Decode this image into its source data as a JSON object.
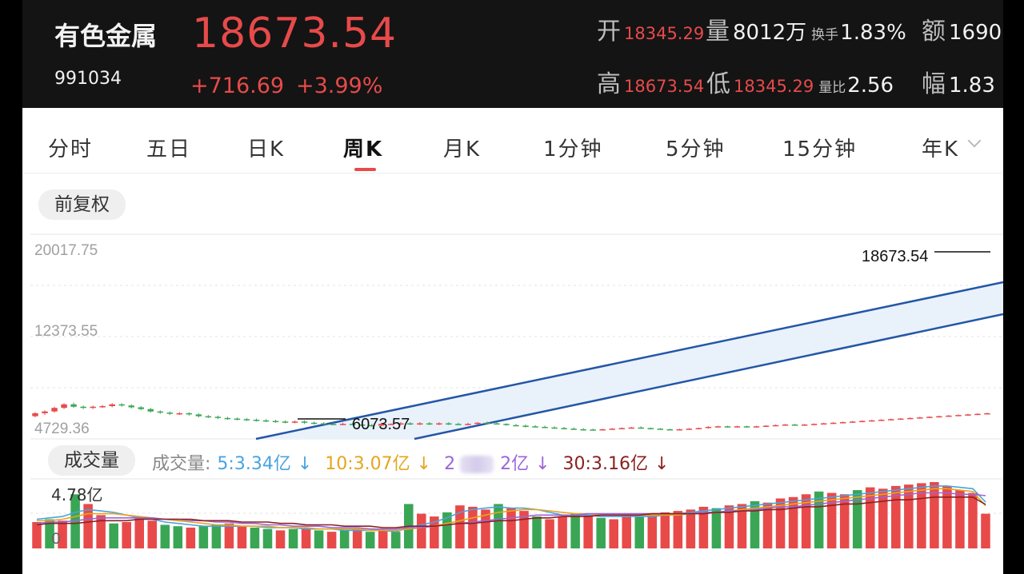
{
  "quote": {
    "name": "有色金属",
    "code": "991034",
    "price": "18673.54",
    "change": "+716.69",
    "change_pct": "+3.99%",
    "open_label": "开",
    "open": "18345.29",
    "volume_label": "量",
    "volume": "8012万",
    "turnover_label": "换手",
    "turnover": "1.83%",
    "amount_label": "额",
    "amount": "1690",
    "high_label": "高",
    "high": "18673.54",
    "low_label": "低",
    "low": "18345.29",
    "volratio_label": "量比",
    "volratio": "2.56",
    "amp_label": "幅",
    "amp": "1.83",
    "up_color": "#e84a4a",
    "down_color": "#3aa655"
  },
  "tabs": [
    {
      "label": "分时"
    },
    {
      "label": "五日"
    },
    {
      "label": "日K"
    },
    {
      "label": "周K",
      "active": true
    },
    {
      "label": "月K"
    },
    {
      "label": "1分钟"
    },
    {
      "label": "5分钟"
    },
    {
      "label": "15分钟"
    },
    {
      "label": "年K"
    }
  ],
  "adjust_label": "前复权",
  "volume_panel": {
    "title": "成交量",
    "legend_prefix": "成交量:",
    "ma5": "5:3.34亿",
    "ma10": "10:3.07亿",
    "ma20_a": "2",
    "ma20_b": "2亿",
    "ma30": "30:3.16亿",
    "down_arrow": "↓",
    "max_label": "4.78亿",
    "zero_label": "0"
  },
  "chart_data": [
    {
      "type": "candlestick",
      "ylim": [
        4729.36,
        20017.75
      ],
      "y_ticks": [
        "20017.75",
        "12373.55",
        "4729.36"
      ],
      "annotations": [
        {
          "text": "18673.54",
          "value": 18673.54,
          "kind": "latest"
        },
        {
          "text": "6073.57",
          "value": 6073.57,
          "kind": "low"
        }
      ],
      "candles": [
        [
          5900,
          6150,
          6250,
          5800
        ],
        [
          6150,
          6300,
          6400,
          6000
        ],
        [
          6300,
          6600,
          6700,
          6200
        ],
        [
          6600,
          6900,
          7000,
          6500
        ],
        [
          6900,
          6700,
          7050,
          6600
        ],
        [
          6700,
          6600,
          6800,
          6500
        ],
        [
          6600,
          6700,
          6800,
          6500
        ],
        [
          6700,
          6750,
          6850,
          6600
        ],
        [
          6750,
          6900,
          7000,
          6650
        ],
        [
          6900,
          6800,
          7000,
          6700
        ],
        [
          6800,
          6650,
          6900,
          6550
        ],
        [
          6650,
          6500,
          6750,
          6400
        ],
        [
          6500,
          6300,
          6600,
          6200
        ],
        [
          6300,
          6200,
          6400,
          6100
        ],
        [
          6200,
          6100,
          6300,
          6000
        ],
        [
          6100,
          6150,
          6250,
          6000
        ],
        [
          6150,
          6050,
          6250,
          5950
        ],
        [
          6050,
          5900,
          6150,
          5800
        ],
        [
          5900,
          5850,
          6000,
          5750
        ],
        [
          5850,
          5750,
          5950,
          5650
        ],
        [
          5750,
          5700,
          5850,
          5600
        ],
        [
          5700,
          5650,
          5800,
          5550
        ],
        [
          5650,
          5600,
          5750,
          5500
        ],
        [
          5600,
          5550,
          5700,
          5450
        ],
        [
          5550,
          5500,
          5650,
          5400
        ],
        [
          5500,
          5450,
          5600,
          5350
        ],
        [
          5450,
          5400,
          5550,
          5300
        ],
        [
          5400,
          5450,
          5550,
          5300
        ],
        [
          5450,
          5350,
          5550,
          5250
        ],
        [
          5350,
          5300,
          5450,
          5200
        ],
        [
          5300,
          5250,
          5400,
          5200
        ],
        [
          5250,
          5200,
          5350,
          5150
        ],
        [
          5200,
          5250,
          5350,
          5150
        ],
        [
          5250,
          5200,
          5350,
          5150
        ],
        [
          5200,
          5150,
          5300,
          5050
        ],
        [
          5150,
          5100,
          5250,
          5000
        ],
        [
          5100,
          5250,
          5350,
          5050
        ],
        [
          5250,
          5250,
          5300,
          5200
        ],
        [
          5250,
          5300,
          5400,
          5150
        ],
        [
          5300,
          5250,
          5400,
          5150
        ],
        [
          5250,
          5300,
          5400,
          5150
        ],
        [
          5300,
          5250,
          5400,
          5150
        ],
        [
          5250,
          5300,
          5400,
          5150
        ],
        [
          5300,
          5250,
          5400,
          5150
        ],
        [
          5250,
          5200,
          5350,
          5150
        ],
        [
          5200,
          5250,
          5350,
          5150
        ],
        [
          5250,
          5350,
          5400,
          5200
        ],
        [
          5350,
          5300,
          5450,
          5250
        ],
        [
          5300,
          5250,
          5400,
          5200
        ],
        [
          5250,
          5150,
          5300,
          5100
        ],
        [
          5150,
          5100,
          5250,
          5050
        ],
        [
          5100,
          5050,
          5200,
          4950
        ],
        [
          5050,
          5000,
          5150,
          4950
        ],
        [
          5000,
          4950,
          5100,
          4900
        ],
        [
          4950,
          4900,
          5050,
          4850
        ],
        [
          4900,
          4850,
          5000,
          4800
        ],
        [
          4850,
          4800,
          4950,
          4750
        ],
        [
          4800,
          4780,
          4900,
          4730
        ],
        [
          4780,
          4750,
          4850,
          4730
        ],
        [
          4750,
          4800,
          4850,
          4730
        ],
        [
          4800,
          4850,
          4900,
          4750
        ],
        [
          4850,
          4900,
          4950,
          4800
        ],
        [
          4900,
          4950,
          5000,
          4850
        ],
        [
          4950,
          4900,
          5050,
          4850
        ],
        [
          4900,
          4850,
          4950,
          4800
        ],
        [
          4850,
          4800,
          4900,
          4750
        ],
        [
          4800,
          4750,
          4850,
          4730
        ],
        [
          4750,
          4800,
          4850,
          4730
        ],
        [
          4800,
          4850,
          4900,
          4760
        ],
        [
          4850,
          4900,
          4950,
          4800
        ],
        [
          4900,
          5000,
          5050,
          4850
        ],
        [
          5000,
          5050,
          5100,
          4950
        ],
        [
          5050,
          5000,
          5100,
          4950
        ],
        [
          5000,
          5050,
          5100,
          4950
        ],
        [
          5050,
          5000,
          5100,
          4950
        ],
        [
          5000,
          5050,
          5100,
          4950
        ],
        [
          5050,
          5100,
          5150,
          5000
        ],
        [
          5100,
          5150,
          5200,
          5050
        ],
        [
          5150,
          5200,
          5250,
          5100
        ],
        [
          5200,
          5150,
          5250,
          5100
        ],
        [
          5150,
          5200,
          5250,
          5100
        ],
        [
          5200,
          5250,
          5300,
          5150
        ],
        [
          5250,
          5300,
          5350,
          5200
        ],
        [
          5300,
          5350,
          5400,
          5250
        ],
        [
          5350,
          5400,
          5450,
          5300
        ],
        [
          5400,
          5450,
          5500,
          5350
        ],
        [
          5450,
          5500,
          5550,
          5400
        ],
        [
          5500,
          5550,
          5600,
          5450
        ],
        [
          5550,
          5600,
          5650,
          5500
        ],
        [
          5600,
          5650,
          5700,
          5550
        ],
        [
          5650,
          5700,
          5750,
          5600
        ],
        [
          5700,
          5750,
          5800,
          5650
        ],
        [
          5750,
          5800,
          5850,
          5700
        ],
        [
          5800,
          5850,
          5900,
          5750
        ],
        [
          5850,
          5900,
          5950,
          5800
        ],
        [
          5900,
          5950,
          6000,
          5850
        ],
        [
          5950,
          6000,
          6050,
          5900
        ],
        [
          6000,
          6050,
          6100,
          5950
        ],
        [
          6050,
          6100,
          6150,
          6000
        ],
        [
          6100,
          6150,
          6200,
          6050
        ]
      ],
      "note": "weekly K-line; values are approximate readings"
    },
    {
      "type": "bar",
      "title": "成交量",
      "ylim": [
        0,
        4.78
      ],
      "unit": "亿",
      "values": [
        1.9,
        2.1,
        2.0,
        3.9,
        3.2,
        2.4,
        1.8,
        1.9,
        2.3,
        2.0,
        1.7,
        1.6,
        1.5,
        1.6,
        1.7,
        1.8,
        1.6,
        1.5,
        1.4,
        1.3,
        1.4,
        1.5,
        1.3,
        1.2,
        1.3,
        1.4,
        1.2,
        1.3,
        1.2,
        3.2,
        2.5,
        2.3,
        2.6,
        3.1,
        3.0,
        2.8,
        3.2,
        2.9,
        2.7,
        2.3,
        2.1,
        2.3,
        2.5,
        2.4,
        2.2,
        2.1,
        2.4,
        2.3,
        2.5,
        2.6,
        2.7,
        2.8,
        3.0,
        2.9,
        3.1,
        3.2,
        3.4,
        3.3,
        3.6,
        3.7,
        3.9,
        4.1,
        4.0,
        3.9,
        4.2,
        4.4,
        4.3,
        4.5,
        4.6,
        4.7,
        4.78,
        4.5,
        4.2,
        4.0,
        2.5
      ],
      "colors": [
        "up",
        "down",
        "up",
        "down",
        "up",
        "up",
        "down",
        "up",
        "up",
        "up",
        "down",
        "down",
        "up",
        "down",
        "down",
        "up",
        "up",
        "down",
        "down",
        "up",
        "down",
        "up",
        "down",
        "up",
        "down",
        "up",
        "down",
        "up",
        "down",
        "down",
        "up",
        "up",
        "down",
        "up",
        "up",
        "up",
        "down",
        "up",
        "up",
        "down",
        "up",
        "up",
        "down",
        "up",
        "down",
        "up",
        "up",
        "down",
        "up",
        "up",
        "up",
        "up",
        "up",
        "down",
        "up",
        "up",
        "down",
        "up",
        "up",
        "up",
        "up",
        "down",
        "up",
        "up",
        "down",
        "up",
        "up",
        "up",
        "up",
        "up",
        "up",
        "up",
        "up",
        "up",
        "up"
      ],
      "series": [
        {
          "name": "5",
          "values": [
            2.1,
            2.2,
            2.3,
            2.6,
            2.8,
            2.7,
            2.6,
            2.4,
            2.2,
            2.1,
            1.9,
            1.8,
            1.7,
            1.6,
            1.6,
            1.6,
            1.6,
            1.6,
            1.5,
            1.5,
            1.5,
            1.4,
            1.4,
            1.4,
            1.3,
            1.3,
            1.3,
            1.3,
            1.2,
            1.5,
            1.7,
            1.9,
            2.2,
            2.6,
            2.8,
            2.9,
            3.0,
            2.9,
            2.9,
            2.8,
            2.6,
            2.4,
            2.4,
            2.4,
            2.3,
            2.3,
            2.3,
            2.3,
            2.3,
            2.4,
            2.5,
            2.6,
            2.7,
            2.8,
            2.9,
            3.0,
            3.1,
            3.2,
            3.3,
            3.4,
            3.5,
            3.6,
            3.7,
            3.8,
            3.9,
            4.0,
            4.1,
            4.2,
            4.3,
            4.4,
            4.5,
            4.5,
            4.4,
            4.3,
            3.34
          ]
        },
        {
          "name": "10",
          "values": [
            2.0,
            2.0,
            2.1,
            2.3,
            2.5,
            2.5,
            2.5,
            2.4,
            2.3,
            2.2,
            2.1,
            2.0,
            1.9,
            1.8,
            1.7,
            1.7,
            1.6,
            1.6,
            1.6,
            1.5,
            1.5,
            1.5,
            1.4,
            1.4,
            1.4,
            1.4,
            1.3,
            1.3,
            1.3,
            1.4,
            1.5,
            1.6,
            1.8,
            2.0,
            2.2,
            2.4,
            2.6,
            2.7,
            2.8,
            2.8,
            2.7,
            2.6,
            2.5,
            2.5,
            2.4,
            2.4,
            2.4,
            2.4,
            2.4,
            2.4,
            2.4,
            2.5,
            2.6,
            2.6,
            2.7,
            2.8,
            2.9,
            3.0,
            3.1,
            3.2,
            3.3,
            3.4,
            3.5,
            3.6,
            3.7,
            3.8,
            3.9,
            4.0,
            4.1,
            4.2,
            4.3,
            4.3,
            4.2,
            4.1,
            3.07
          ]
        },
        {
          "name": "20",
          "values": [
            1.8,
            1.9,
            1.9,
            2.0,
            2.1,
            2.2,
            2.2,
            2.2,
            2.2,
            2.2,
            2.1,
            2.1,
            2.0,
            2.0,
            1.9,
            1.9,
            1.8,
            1.8,
            1.7,
            1.7,
            1.6,
            1.6,
            1.6,
            1.5,
            1.5,
            1.5,
            1.4,
            1.4,
            1.4,
            1.5,
            1.5,
            1.6,
            1.7,
            1.8,
            1.9,
            2.0,
            2.1,
            2.2,
            2.3,
            2.4,
            2.4,
            2.4,
            2.4,
            2.5,
            2.5,
            2.5,
            2.5,
            2.5,
            2.5,
            2.5,
            2.5,
            2.5,
            2.6,
            2.6,
            2.7,
            2.7,
            2.8,
            2.9,
            3.0,
            3.0,
            3.1,
            3.2,
            3.3,
            3.4,
            3.5,
            3.6,
            3.7,
            3.8,
            3.9,
            4.0,
            4.0,
            4.0,
            3.9,
            3.9,
            3.8
          ]
        },
        {
          "name": "30",
          "values": [
            1.7,
            1.8,
            1.8,
            1.8,
            1.9,
            2.0,
            2.0,
            2.0,
            2.1,
            2.1,
            2.1,
            2.1,
            2.1,
            2.0,
            2.0,
            2.0,
            1.9,
            1.9,
            1.9,
            1.8,
            1.8,
            1.7,
            1.7,
            1.7,
            1.6,
            1.6,
            1.6,
            1.5,
            1.5,
            1.6,
            1.6,
            1.6,
            1.7,
            1.8,
            1.8,
            1.9,
            2.0,
            2.0,
            2.1,
            2.2,
            2.2,
            2.3,
            2.3,
            2.3,
            2.4,
            2.4,
            2.4,
            2.4,
            2.5,
            2.5,
            2.5,
            2.5,
            2.5,
            2.6,
            2.6,
            2.7,
            2.7,
            2.8,
            2.8,
            2.9,
            3.0,
            3.0,
            3.1,
            3.2,
            3.2,
            3.3,
            3.4,
            3.5,
            3.5,
            3.6,
            3.7,
            3.7,
            3.7,
            3.7,
            3.16
          ]
        }
      ]
    }
  ]
}
